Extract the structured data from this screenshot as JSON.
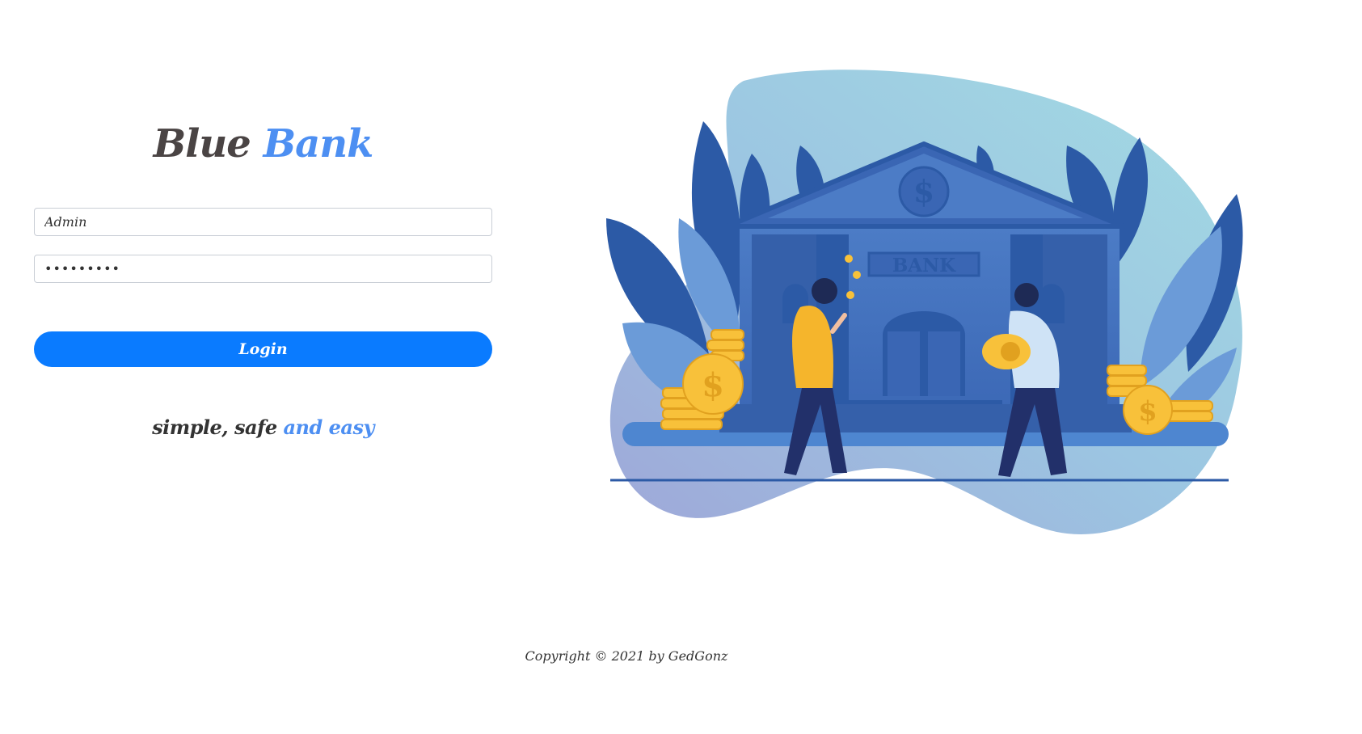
{
  "brand": {
    "word1": "Blue",
    "word2": "Bank"
  },
  "login_form": {
    "username_value": "Admin",
    "password_value": "•••••••••",
    "login_label": "Login"
  },
  "tagline": {
    "part1": "simple, safe ",
    "part2": "and easy"
  },
  "illustration": {
    "sign_text": "BANK",
    "currency_symbol": "$"
  },
  "footer": {
    "copyright": "Copyright © 2021 by GedGonz"
  },
  "colors": {
    "accent": "#0a7bff",
    "brand_blue": "#4d8ff2",
    "text_dark": "#4a4444"
  }
}
